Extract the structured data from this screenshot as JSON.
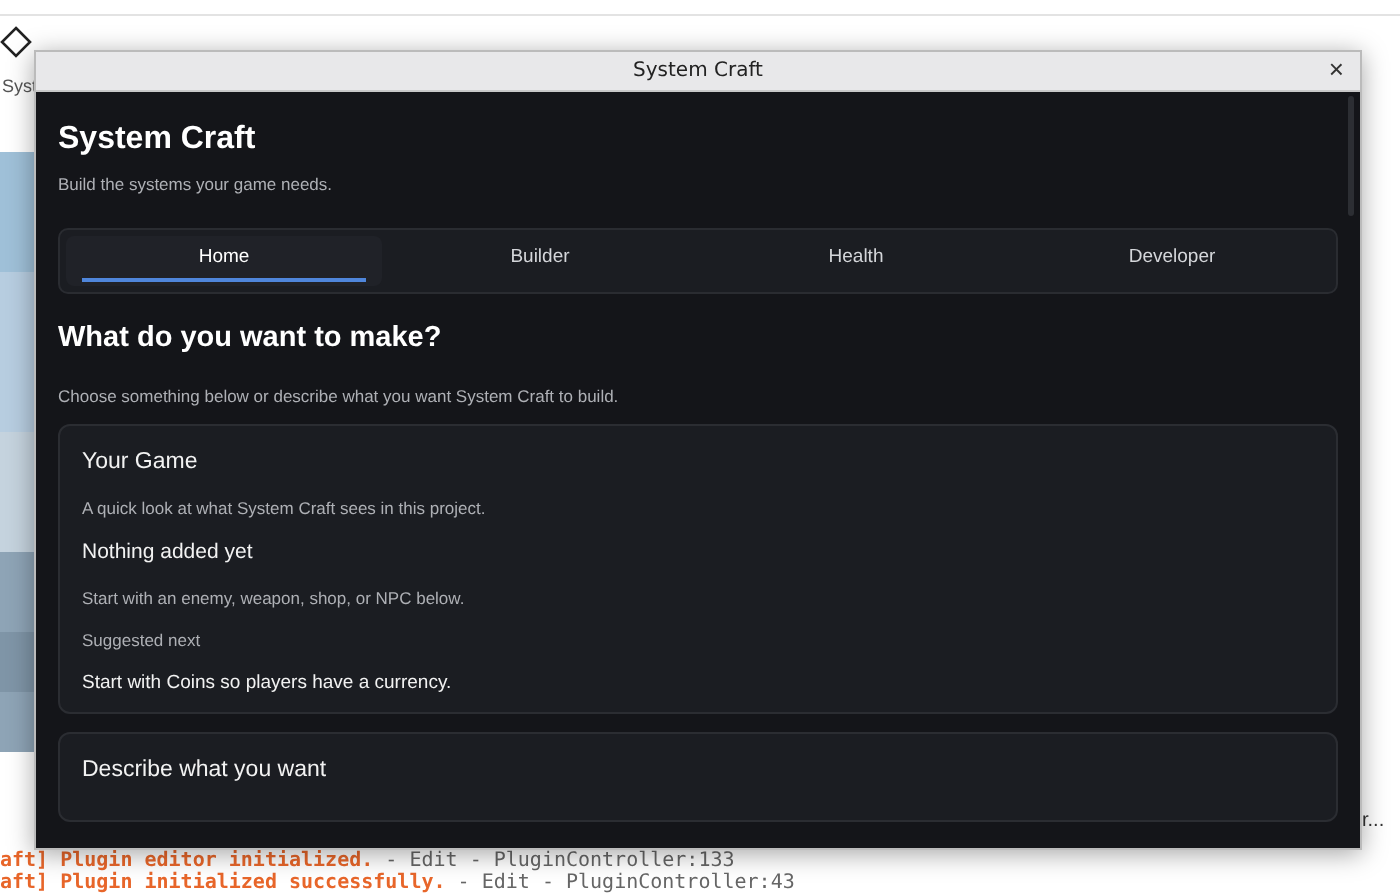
{
  "studio": {
    "toolbar_label": "Syst",
    "side_label": "r...",
    "console": [
      {
        "message": "aft] Plugin editor initialized.",
        "source": "-  Edit - PluginController:133"
      },
      {
        "message": "aft] Plugin initialized successfully.",
        "source": "-  Edit - PluginController:43"
      }
    ]
  },
  "dialog": {
    "title": "System Craft",
    "close": "×",
    "heading": "System Craft",
    "subtitle": "Build the systems your game needs.",
    "tabs": [
      {
        "label": "Home",
        "selected": true
      },
      {
        "label": "Builder",
        "selected": false
      },
      {
        "label": "Health",
        "selected": false
      },
      {
        "label": "Developer",
        "selected": false
      }
    ],
    "section_title": "What do you want to make?",
    "section_text": "Choose something below or describe what you want System Craft to build.",
    "cards": [
      {
        "title": "Your Game",
        "lines": [
          {
            "kind": "note",
            "text": "A quick look at what System Craft sees in this project."
          },
          {
            "kind": "subheading",
            "text": "Nothing added yet"
          },
          {
            "kind": "note",
            "text": "Start with an enemy, weapon, shop, or NPC below."
          },
          {
            "kind": "note",
            "text": "Suggested next"
          },
          {
            "kind": "strong",
            "text": "Start with Coins so players have a currency."
          }
        ]
      },
      {
        "title": "Describe what you want"
      }
    ]
  }
}
